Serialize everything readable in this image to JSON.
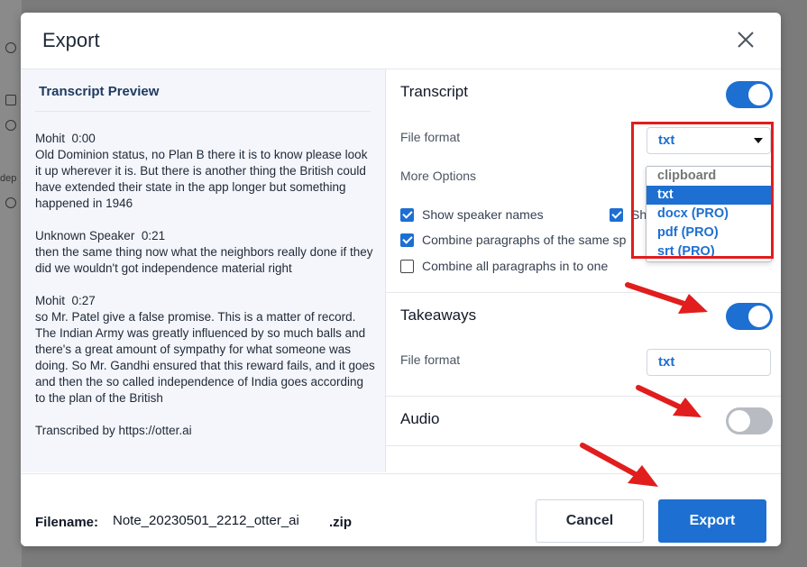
{
  "modal": {
    "title": "Export"
  },
  "preview": {
    "title": "Transcript Preview",
    "segments": [
      {
        "speaker": "Mohit",
        "time": "0:00",
        "text": "Old Dominion status, no Plan B there it is to know please look it up wherever it is. But there is another thing the British could have extended their state in the app longer but something happened in 1946"
      },
      {
        "speaker": "Unknown Speaker",
        "time": "0:21",
        "text": "then the same thing now what the neighbors really done if they did we wouldn't got independence material right"
      },
      {
        "speaker": "Mohit",
        "time": "0:27",
        "text": "so Mr. Patel give a false promise. This is a matter of record. The Indian Army was greatly influenced by so much balls and there's a great amount of sympathy for what someone was doing. So Mr. Gandhi ensured that this reward fails, and it goes and then the so called independence of India goes according to the plan of the British"
      }
    ],
    "credit": "Transcribed by https://otter.ai"
  },
  "transcript": {
    "title": "Transcript",
    "enabled": true,
    "file_format_label": "File format",
    "selected_format": "txt",
    "more_options_label": "More Options",
    "format_options": [
      "clipboard",
      "txt",
      "docx (PRO)",
      "pdf (PRO)",
      "srt (PRO)"
    ],
    "options": [
      {
        "label": "Show speaker names",
        "checked": true
      },
      {
        "label": "Sh",
        "checked": true
      },
      {
        "label": "Combine paragraphs of the same sp",
        "checked": true
      },
      {
        "label": "Combine all paragraphs in to one",
        "checked": false
      }
    ]
  },
  "takeaways": {
    "title": "Takeaways",
    "enabled": true,
    "file_format_label": "File format",
    "selected_format": "txt"
  },
  "audio": {
    "title": "Audio",
    "enabled": false
  },
  "footer": {
    "filename_label": "Filename:",
    "filename_value": "Note_20230501_2212_otter_ai",
    "filename_ext": ".zip",
    "cancel_label": "Cancel",
    "export_label": "Export"
  },
  "colors": {
    "accent": "#1d6fd1",
    "annotation": "#e11d1d",
    "toggle_off": "#b8bcc2"
  },
  "background": {
    "partial_text": "dep"
  }
}
